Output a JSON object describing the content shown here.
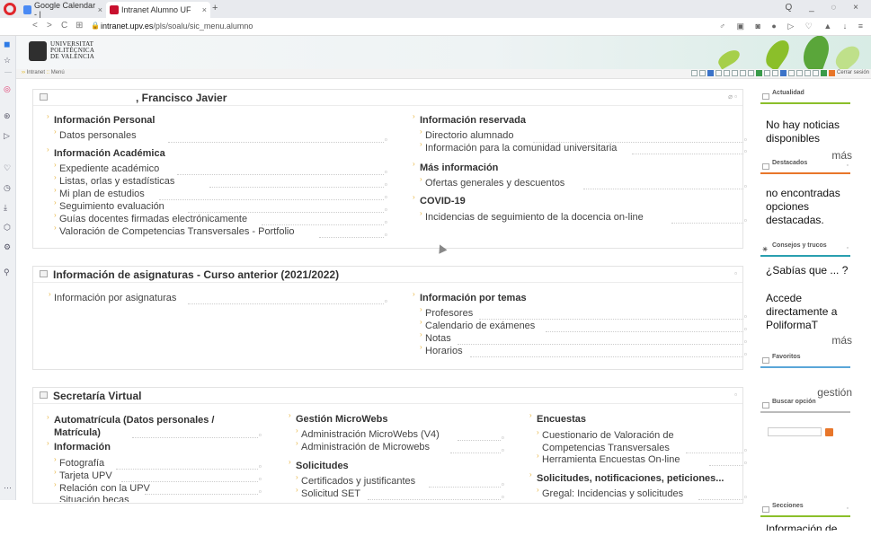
{
  "browser": {
    "tabs": [
      {
        "label": "Google Calendar - |",
        "close": "×"
      },
      {
        "label": "Intranet Alumno UF",
        "close": "×"
      }
    ],
    "new_tab": "+",
    "window_controls": "Q _ ◌ ×",
    "nav": {
      "back": "<",
      "forward": ">",
      "reload": "C",
      "grid": "⊞"
    },
    "url_host": "intranet.upv.es",
    "url_path": "/pls/soalu/sic_menu.alumno",
    "tool_icons": "♂ ▣ ◙ ● ▷ ♡ ▲ ↓ ≡"
  },
  "header": {
    "university": [
      "UNIVERSITAT",
      "POLITÈCNICA",
      "DE VALÈNCIA"
    ],
    "breadcrumb_root": "Intranet",
    "breadcrumb_current": "Menú",
    "logout": "Cerrar sesión"
  },
  "panel_personal": {
    "title": ", Francisco Javier",
    "left": [
      {
        "section": "Información Personal",
        "links": [
          "Datos personales"
        ]
      },
      {
        "section": "Información Académica",
        "links": [
          "Expediente académico",
          "Listas, orlas y estadísticas",
          "Mi plan de estudios",
          "Seguimiento evaluación",
          "Guías docentes firmadas electrónicamente",
          "Valoración de Competencias Transversales - Portfolio"
        ]
      }
    ],
    "right": [
      {
        "section": "Información reservada",
        "links": [
          "Directorio alumnado",
          "Información para la comunidad universitaria"
        ]
      },
      {
        "section": "Más información",
        "links": [
          "Ofertas generales y descuentos"
        ]
      },
      {
        "section": "COVID-19",
        "links": [
          "Incidencias de seguimiento de la docencia on-line"
        ]
      }
    ]
  },
  "panel_asignaturas": {
    "title": "Información de asignaturas - Curso anterior (2021/2022)",
    "left_link": "Información por asignaturas",
    "right_section": "Información por temas",
    "right_links": [
      "Profesores",
      "Calendario de exámenes",
      "Notas",
      "Horarios"
    ]
  },
  "panel_secretaria": {
    "title": "Secretaría Virtual",
    "col1_section": "Automatrícula (Datos personales / Matrícula)",
    "col1_section2": "Información",
    "col1_links": [
      "Fotografía",
      "Tarjeta UPV",
      "Relación con la UPV",
      "Situación becas"
    ],
    "col2_section": "Gestión MicroWebs",
    "col2_links": [
      "Administración MicroWebs (V4)",
      "Administración de Microwebs"
    ],
    "col2_section2": "Solicitudes",
    "col2_links2": [
      "Certificados y justificantes",
      "Solicitud SET"
    ],
    "col3_section": "Encuestas",
    "col3_links": [
      "Cuestionario de Valoración de Competencias Transversales",
      "Herramienta Encuestas On-line"
    ],
    "col3_section2": "Solicitudes, notificaciones, peticiones...",
    "col3_links2": [
      "Gregal: Incidencias y solicitudes"
    ]
  },
  "right_column": {
    "actualidad": "Actualidad",
    "actualidad_text": "No hay noticias disponibles",
    "more": "más",
    "destacados": "Destacados",
    "destacados_text": "no encontradas opciones destacadas.",
    "consejos": "Consejos y trucos",
    "consejos_text1": "¿Sabías que ... ?",
    "consejos_text2": "Accede directamente a PoliformaT",
    "favoritos": "Favoritos",
    "gestion": "gestión",
    "buscar": "Buscar opción",
    "secciones": "Secciones",
    "secciones_text": "Información de"
  },
  "colors": {
    "accent_yellow": "#e8b84a",
    "bar_green": "#8bbf2a",
    "bar_orange": "#e8762a",
    "bar_blue": "#5aa6d8",
    "bar_teal": "#2a9fb0"
  }
}
